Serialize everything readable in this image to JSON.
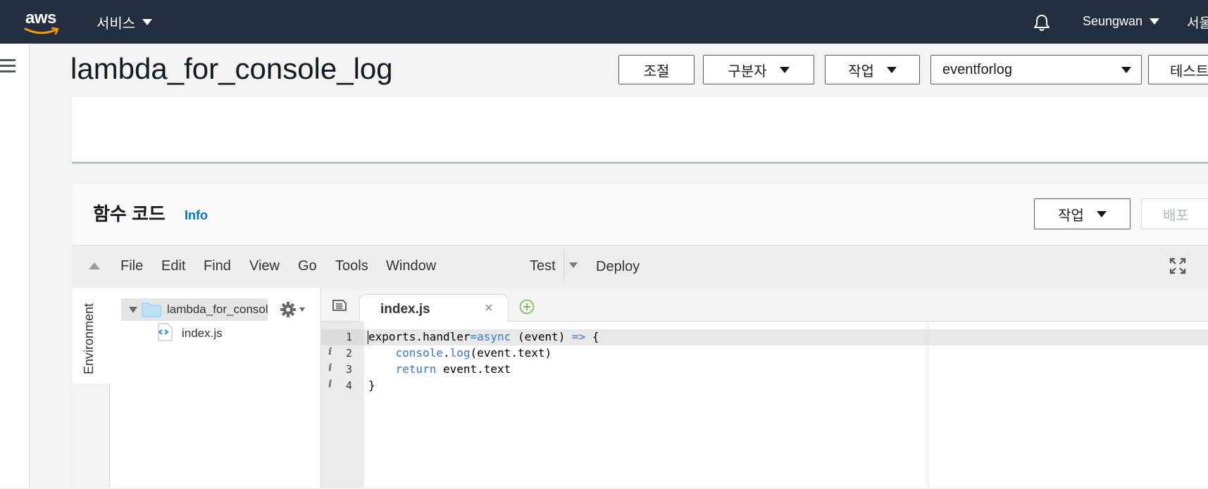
{
  "topbar": {
    "logo_text": "aws",
    "services_label": "서비스",
    "user_label": "Seungwan",
    "region_label": "서울"
  },
  "header": {
    "title": "lambda_for_console_log",
    "buttons": {
      "throttle": "조절",
      "qualifiers": "구분자",
      "actions": "작업",
      "test_event": "eventforlog",
      "test": "테스트"
    }
  },
  "code_section": {
    "title": "함수 코드",
    "info_link": "Info",
    "actions_button": "작업",
    "deploy_button": "배포"
  },
  "ide": {
    "menu": [
      "File",
      "Edit",
      "Find",
      "View",
      "Go",
      "Tools",
      "Window"
    ],
    "test_label": "Test",
    "deploy_label": "Deploy",
    "environment_tab": "Environment",
    "tree": {
      "root": "lambda_for_console_log",
      "files": [
        "index.js"
      ]
    },
    "active_tab": "index.js",
    "close_glyph": "×",
    "line_numbers": [
      "1",
      "2",
      "3",
      "4"
    ],
    "code_lines": [
      "exports.handler=async (event) => {",
      "    console.log(event.text)",
      "    return event.text",
      "}"
    ]
  },
  "colors": {
    "topbar": "#232f3e",
    "link": "#0073bb"
  }
}
